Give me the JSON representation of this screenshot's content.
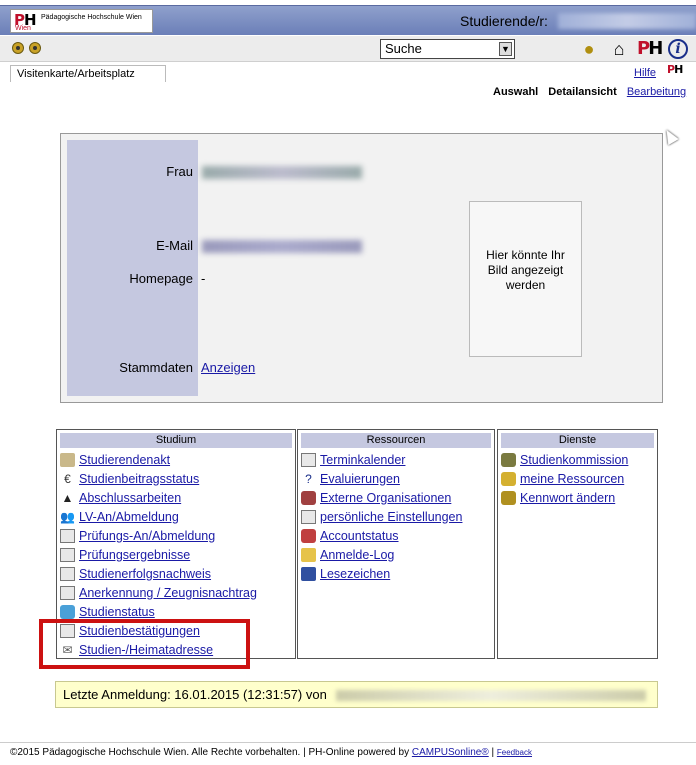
{
  "header": {
    "logo_text": "PH",
    "logo_sub": "Wien",
    "logo_name": "Pädagogische Hochschule Wien",
    "user_label": "Studierende/r:"
  },
  "toolbar": {
    "search_value": "Suche"
  },
  "tabs": [
    {
      "label": "Visitenkarte/Arbeitsplatz"
    }
  ],
  "help_label": "Hilfe",
  "view_nav": {
    "auswahl": "Auswahl",
    "detail": "Detailansicht",
    "edit": "Bearbeitung"
  },
  "card": {
    "title_label": "Frau",
    "email_label": "E-Mail",
    "homepage_label": "Homepage",
    "homepage_value": "-",
    "stammdaten_label": "Stammdaten",
    "stammdaten_link": "Anzeigen",
    "photo_text": "Hier könnte Ihr Bild angezeigt werden"
  },
  "studium": {
    "title": "Studium",
    "items": [
      {
        "label": "Studierendenakt",
        "icon": "folder-icon"
      },
      {
        "label": "Studienbeitragsstatus",
        "icon": "euro-icon"
      },
      {
        "label": "Abschlussarbeiten",
        "icon": "graduation-cap-icon"
      },
      {
        "label": "LV-An/Abmeldung",
        "icon": "people-icon"
      },
      {
        "label": "Prüfungs-An/Abmeldung",
        "icon": "exam-icon"
      },
      {
        "label": "Prüfungsergebnisse",
        "icon": "results-icon"
      },
      {
        "label": "Studienerfolgsnachweis",
        "icon": "document-icon"
      },
      {
        "label": "Anerkennung / Zeugnisnachtrag",
        "icon": "certificate-icon"
      },
      {
        "label": "Studienstatus",
        "icon": "status-icon"
      },
      {
        "label": "Studienbestätigungen",
        "icon": "confirmation-icon"
      },
      {
        "label": "Studien-/Heimatadresse",
        "icon": "envelope-icon"
      }
    ]
  },
  "ressourcen": {
    "title": "Ressourcen",
    "items": [
      {
        "label": "Terminkalender",
        "icon": "calendar-icon"
      },
      {
        "label": "Evaluierungen",
        "icon": "question-icon"
      },
      {
        "label": "Externe Organisationen",
        "icon": "handshake-icon"
      },
      {
        "label": "persönliche Einstellungen",
        "icon": "settings-icon"
      },
      {
        "label": "Accountstatus",
        "icon": "account-icon"
      },
      {
        "label": "Anmelde-Log",
        "icon": "log-icon"
      },
      {
        "label": "Lesezeichen",
        "icon": "bookmark-icon"
      }
    ]
  },
  "dienste": {
    "title": "Dienste",
    "items": [
      {
        "label": "Studienkommission",
        "icon": "commission-icon"
      },
      {
        "label": "meine Ressourcen",
        "icon": "key-icon"
      },
      {
        "label": "Kennwort ändern",
        "icon": "password-icon"
      }
    ]
  },
  "last_login": {
    "text": "Letzte Anmeldung: 16.01.2015 (12:31:57) von"
  },
  "footer": {
    "copyright": "©2015 Pädagogische Hochschule Wien. Alle Rechte vorbehalten. | PH-Online powered by ",
    "campus_link": "CAMPUSonline®",
    "sep": " | ",
    "feedback": "Feedback"
  },
  "colors": {
    "header_blue": "#7b8cc4",
    "menu_header": "#c5c8e0",
    "link_blue": "#1a1aa6",
    "highlight_red": "#cc1111",
    "lastlogin_bg": "#ffffcc"
  }
}
